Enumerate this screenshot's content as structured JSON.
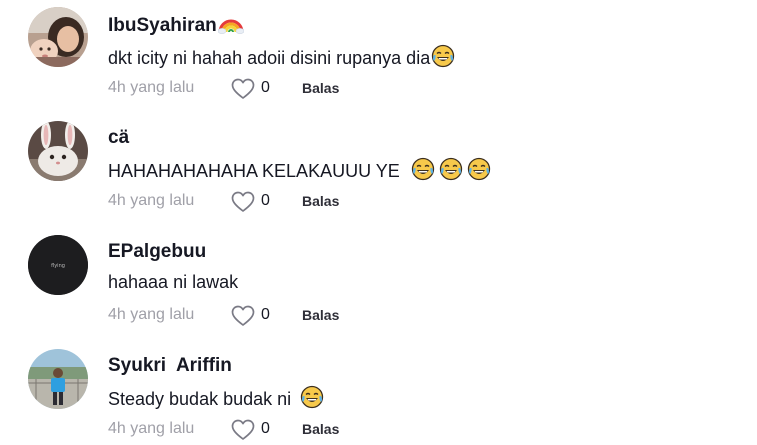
{
  "comments": [
    {
      "username": "IbuSyahiran",
      "badge_icon": "rainbow-icon",
      "text": "dkt icity ni hahah adoii disini rupanya dia",
      "emojis": [
        "tears-of-joy-icon"
      ],
      "time": "4h yang lalu",
      "likes": "0",
      "reply_label": "Balas"
    },
    {
      "username": "cä",
      "text": "HAHAHAHAHAHA KELAKAUUU YE",
      "emojis": [
        "tears-of-joy-icon",
        "tears-of-joy-icon",
        "tears-of-joy-icon"
      ],
      "time": "4h yang lalu",
      "likes": "0",
      "reply_label": "Balas"
    },
    {
      "username": "EPalgebuu",
      "avatar_text": "flying",
      "text": "hahaaa ni lawak",
      "time": "4h yang lalu",
      "likes": "0",
      "reply_label": "Balas"
    },
    {
      "username": "Syukri  Ariffin",
      "text": "Steady budak budak ni",
      "emojis": [
        "tears-of-joy-icon"
      ],
      "time": "4h yang lalu",
      "likes": "0",
      "reply_label": "Balas"
    }
  ],
  "colors": {
    "text": "#161823",
    "meta": "#a0a0a8",
    "emoji_face": "#f7c94b"
  }
}
